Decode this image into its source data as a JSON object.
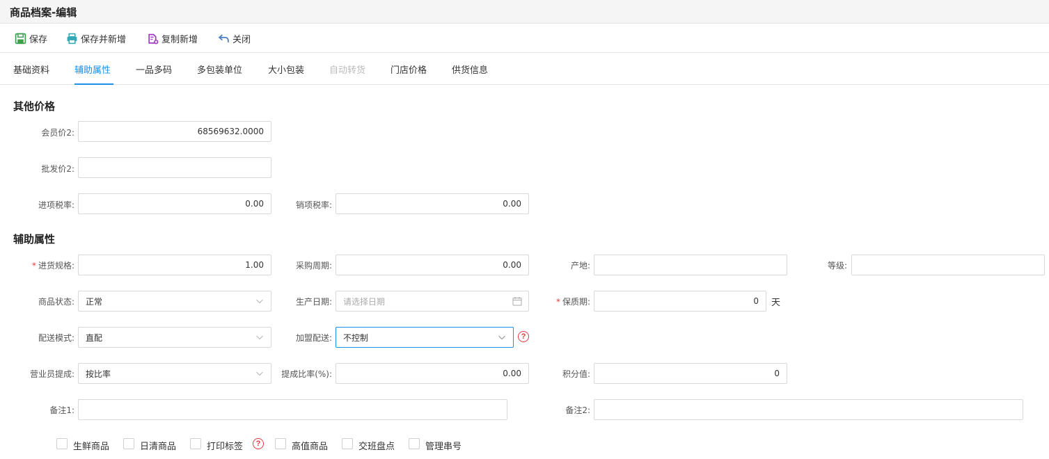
{
  "window": {
    "title": "商品档案-编辑"
  },
  "toolbar": {
    "save": "保存",
    "save_new": "保存并新增",
    "copy_new": "复制新增",
    "close": "关闭",
    "colors": {
      "save": "#3aa04a",
      "save_new": "#33a9b5",
      "copy_new": "#9b3cc2",
      "close": "#4a7fc1"
    }
  },
  "tabs": [
    {
      "label": "基础资料"
    },
    {
      "label": "辅助属性"
    },
    {
      "label": "一品多码"
    },
    {
      "label": "多包装单位"
    },
    {
      "label": "大小包装"
    },
    {
      "label": "自动转货"
    },
    {
      "label": "门店价格"
    },
    {
      "label": "供货信息"
    }
  ],
  "active_tab": "辅助属性",
  "other_price": {
    "title": "其他价格",
    "member_price2": {
      "label": "会员价2:",
      "value": "68569632.0000"
    },
    "wholesale_price2": {
      "label": "批发价2:",
      "value": ""
    },
    "input_tax": {
      "label": "进项税率:",
      "value": "0.00"
    },
    "output_tax": {
      "label": "销项税率:",
      "value": "0.00"
    }
  },
  "aux": {
    "title": "辅助属性",
    "spec": {
      "label": "进货规格:",
      "value": "1.00",
      "required_mark": "*"
    },
    "purchase_cycle": {
      "label": "采购周期:",
      "value": "0.00"
    },
    "origin": {
      "label": "产地:",
      "value": ""
    },
    "grade": {
      "label": "等级:",
      "value": ""
    },
    "status": {
      "label": "商品状态:",
      "value": "正常"
    },
    "prod_date": {
      "label": "生产日期:",
      "placeholder": "请选择日期"
    },
    "shelf_life": {
      "label": "保质期:",
      "value": "0",
      "unit": "天",
      "required_mark": "*"
    },
    "delivery_mode": {
      "label": "配送模式:",
      "value": "直配"
    },
    "franchise_delivery": {
      "label": "加盟配送:",
      "value": "不控制"
    },
    "sales_commission": {
      "label": "营业员提成:",
      "value": "按比率"
    },
    "commission_rate": {
      "label": "提成比率(%):",
      "value": "0.00"
    },
    "points": {
      "label": "积分值:",
      "value": "0"
    },
    "note1": {
      "label": "备注1:",
      "value": ""
    },
    "note2": {
      "label": "备注2:",
      "value": ""
    }
  },
  "checkboxes": [
    {
      "label": "生鲜商品",
      "checked": false
    },
    {
      "label": "日清商品",
      "checked": false
    },
    {
      "label": "打印标签",
      "checked": false
    },
    {
      "label": "高值商品",
      "checked": false
    },
    {
      "label": "交班盘点",
      "checked": false
    },
    {
      "label": "管理串号",
      "checked": false
    }
  ],
  "help_glyph": "?"
}
